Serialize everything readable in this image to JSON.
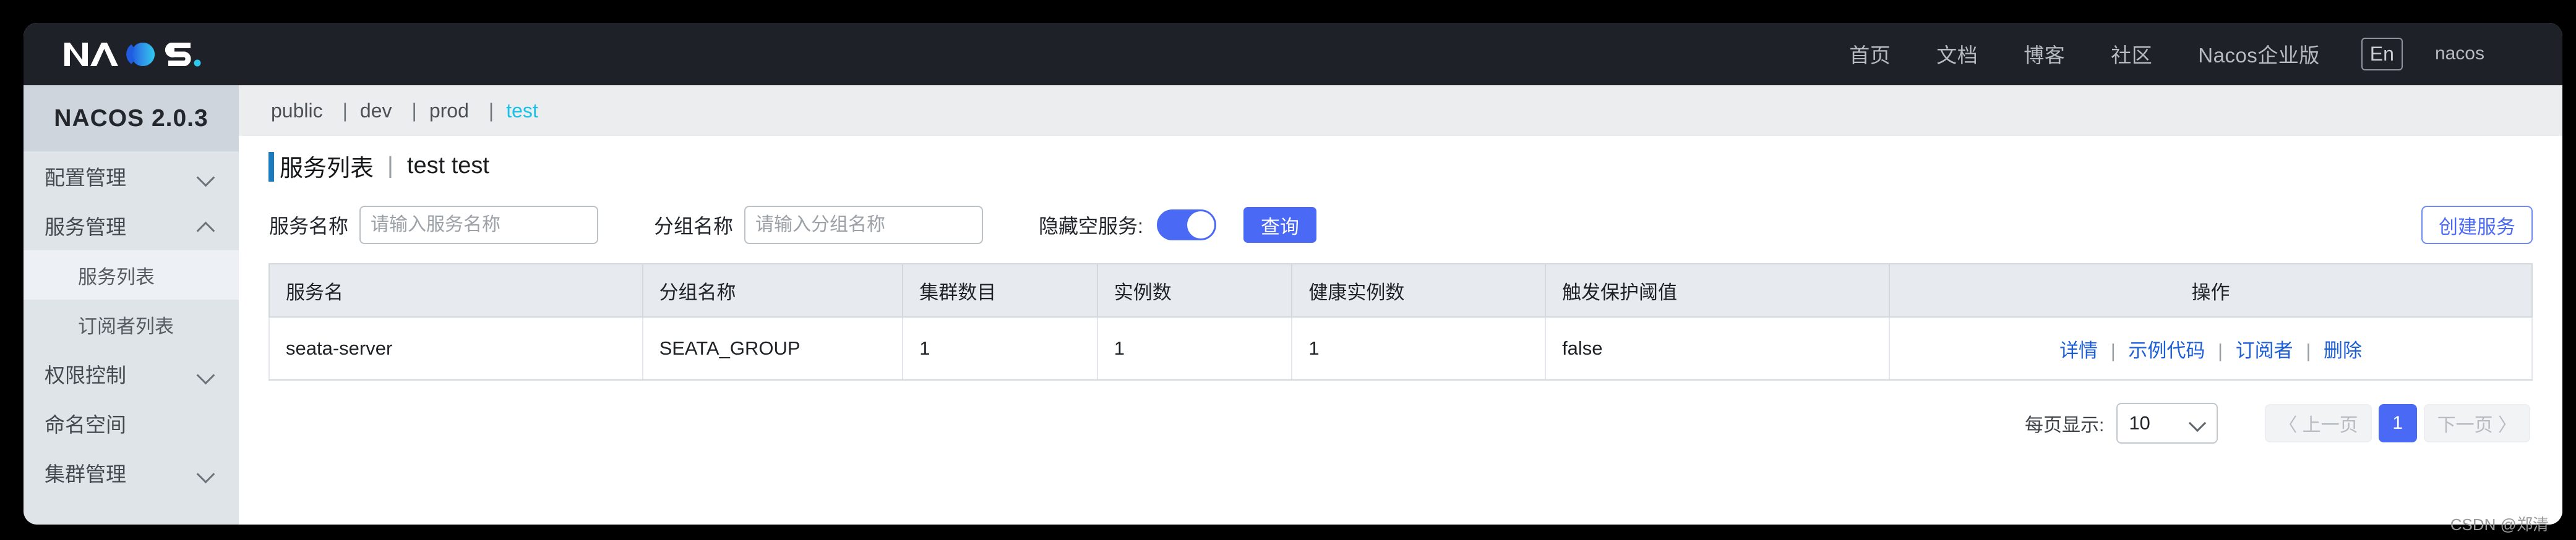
{
  "navbar": {
    "logo_text": "NACOS.",
    "links": [
      {
        "label": "首页"
      },
      {
        "label": "文档"
      },
      {
        "label": "博客"
      },
      {
        "label": "社区"
      },
      {
        "label": "Nacos企业版"
      }
    ],
    "lang_toggle": "En",
    "user": "nacos",
    "bg_color": "#1e2228"
  },
  "sidebar": {
    "brand": "NACOS 2.0.3",
    "items": [
      {
        "label": "配置管理",
        "icon": "chevron-down-icon",
        "expandable": true,
        "expanded": false,
        "active": false,
        "sub": false
      },
      {
        "label": "服务管理",
        "icon": "chevron-up-icon",
        "expandable": true,
        "expanded": true,
        "active": false,
        "sub": false
      },
      {
        "label": "服务列表",
        "icon": "",
        "expandable": false,
        "expanded": false,
        "active": true,
        "sub": true
      },
      {
        "label": "订阅者列表",
        "icon": "",
        "expandable": false,
        "expanded": false,
        "active": false,
        "sub": true
      },
      {
        "label": "权限控制",
        "icon": "chevron-down-icon",
        "expandable": true,
        "expanded": false,
        "active": false,
        "sub": false
      },
      {
        "label": "命名空间",
        "icon": "",
        "expandable": false,
        "expanded": false,
        "active": false,
        "sub": false
      },
      {
        "label": "集群管理",
        "icon": "chevron-down-icon",
        "expandable": true,
        "expanded": false,
        "active": false,
        "sub": false
      }
    ]
  },
  "namespaces": {
    "tabs": [
      {
        "label": "public",
        "active": false
      },
      {
        "label": "dev",
        "active": false
      },
      {
        "label": "prod",
        "active": false
      },
      {
        "label": "test",
        "active": true
      }
    ],
    "separator": "|",
    "active_color": "#1ec0e8"
  },
  "page": {
    "title": "服务列表",
    "title_separator": "|",
    "namespace_label": "test  test",
    "accent_bar_color": "#1b7bbd"
  },
  "filters": {
    "service_name_label": "服务名称",
    "service_name_value": "",
    "service_name_placeholder": "请输入服务名称",
    "group_name_label": "分组名称",
    "group_name_value": "",
    "group_name_placeholder": "请输入分组名称",
    "hide_empty_label": "隐藏空服务:",
    "hide_empty_on": true,
    "query_button": "查询",
    "create_button": "创建服务",
    "accent_color": "#4a69f5"
  },
  "table": {
    "columns": [
      {
        "label": "服务名",
        "align": "left"
      },
      {
        "label": "分组名称",
        "align": "left"
      },
      {
        "label": "集群数目",
        "align": "left"
      },
      {
        "label": "实例数",
        "align": "left"
      },
      {
        "label": "健康实例数",
        "align": "left"
      },
      {
        "label": "触发保护阈值",
        "align": "left"
      },
      {
        "label": "操作",
        "align": "center"
      }
    ],
    "rows": [
      {
        "service_name": "seata-server",
        "group_name": "SEATA_GROUP",
        "cluster_count": "1",
        "instance_count": "1",
        "healthy_instance_count": "1",
        "protect_threshold": "false",
        "actions": [
          {
            "label": "详情"
          },
          {
            "label": "示例代码"
          },
          {
            "label": "订阅者"
          },
          {
            "label": "删除"
          }
        ],
        "action_separator": "|"
      }
    ],
    "link_color": "#1c5fd6"
  },
  "pagination": {
    "page_size_label": "每页显示:",
    "page_size_value": "10",
    "prev_label": "〈 上一页",
    "next_label": "下一页 〉",
    "current_page": "1",
    "prev_disabled": true,
    "next_disabled": true
  },
  "watermark": "CSDN @郑清"
}
